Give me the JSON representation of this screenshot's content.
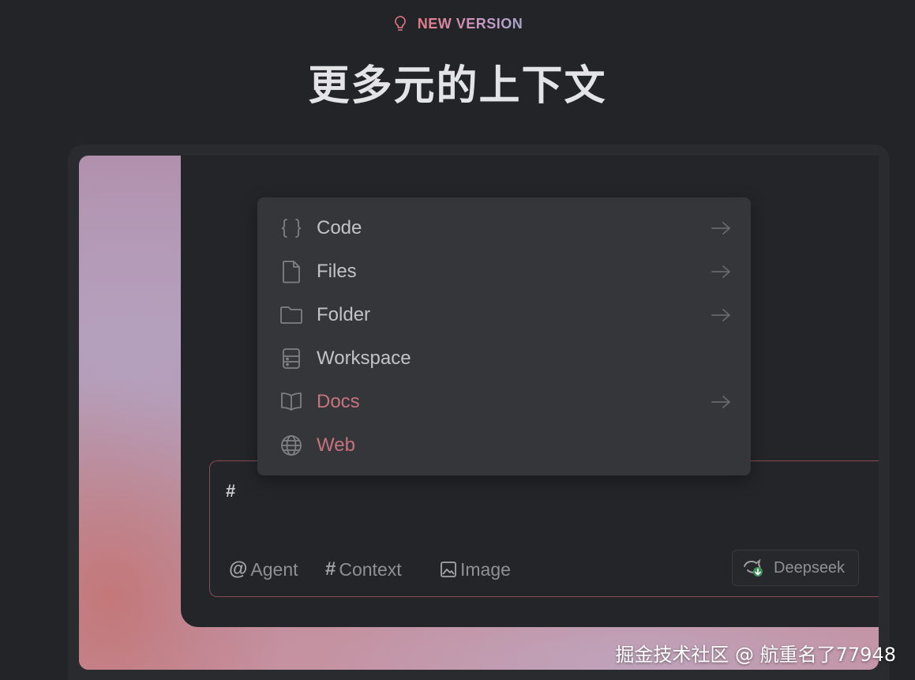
{
  "header": {
    "badge_icon": "lightbulb-icon",
    "badge_text": "NEW VERSION",
    "title": "更多元的上下文"
  },
  "context_menu": {
    "items": [
      {
        "label": "Code",
        "icon": "code-braces-icon",
        "has_arrow": true
      },
      {
        "label": "Files",
        "icon": "file-icon",
        "has_arrow": true
      },
      {
        "label": "Folder",
        "icon": "folder-icon",
        "has_arrow": true
      },
      {
        "label": "Workspace",
        "icon": "workspace-icon",
        "has_arrow": false
      },
      {
        "label": "Docs",
        "icon": "book-icon",
        "has_arrow": true
      },
      {
        "label": "Web",
        "icon": "globe-icon",
        "has_arrow": false
      }
    ]
  },
  "chat_input": {
    "value": "#",
    "toolbar": {
      "agent_symbol": "@",
      "agent_label": "Agent",
      "context_symbol": "#",
      "context_label": "Context",
      "image_label": "Image"
    },
    "model_label": "Deepseek"
  },
  "watermark": "掘金技术社区 @ 航重名了77948",
  "colors": {
    "background": "#232428",
    "menu_background": "#35363a",
    "accent": "#c5737e",
    "input_border": "#8a4c55"
  }
}
